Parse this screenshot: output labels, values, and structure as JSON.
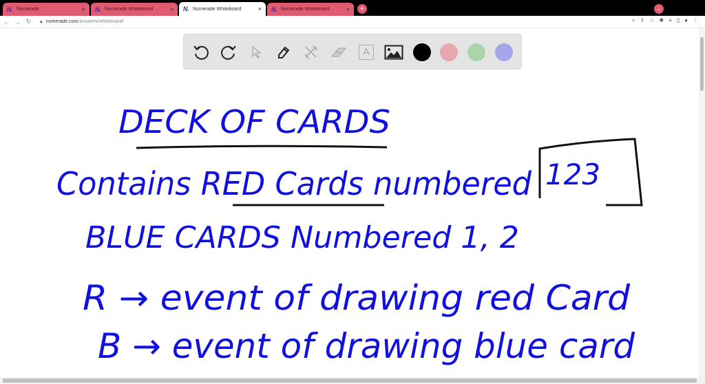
{
  "browser": {
    "tabs": [
      {
        "label": "Numerade",
        "active": false
      },
      {
        "label": "Numerade Whiteboard",
        "active": false
      },
      {
        "label": "Numerade Whiteboard",
        "active": true
      },
      {
        "label": "Numerade Whiteboard",
        "active": false
      }
    ],
    "tab_logo": "N.",
    "close_glyph": "×",
    "new_tab_glyph": "+",
    "url_domain": "numerade.com",
    "url_path": "/answers/whiteboard/",
    "accent": "#e05a70"
  },
  "toolbar": {
    "tools": [
      "undo",
      "redo",
      "select",
      "pen",
      "tools",
      "eraser",
      "text",
      "image"
    ],
    "colors": [
      "#000000",
      "#e8a6ae",
      "#acd4ac",
      "#a6a6e8"
    ],
    "text_tool_glyph": "A"
  },
  "whiteboard": {
    "ink_color": "#1010e0",
    "lines": [
      "DECK OF CARDS",
      "Contains RED Cards numbered",
      "123",
      "BLUE CARDS Numbered 1, 2",
      "R → event of drawing red Card",
      "B → event of drawing blue card"
    ]
  }
}
